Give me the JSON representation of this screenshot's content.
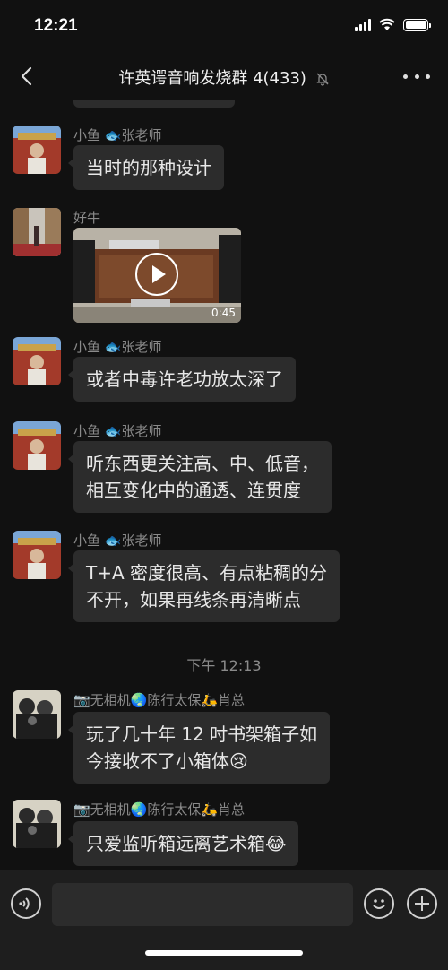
{
  "status_bar": {
    "time": "12:21"
  },
  "nav": {
    "title": "许英谔音响发烧群 4(433)"
  },
  "messages": [
    {
      "sender": "小鱼 🐟张老师",
      "text": "当时的那种设计"
    },
    {
      "sender": "好牛",
      "video_duration": "0:45"
    },
    {
      "sender": "小鱼 🐟张老师",
      "text": "或者中毒许老功放太深了"
    },
    {
      "sender": "小鱼 🐟张老师",
      "line1": "听东西更关注高、中、低音，",
      "line2": "相互变化中的通透、连贯度"
    },
    {
      "sender": "小鱼 🐟张老师",
      "line1": "T+A 密度很高、有点粘稠的分",
      "line2": "不开，如果再线条再清晰点"
    },
    {
      "sender": "📷无相机🌏陈行太保🛵肖总",
      "line1": "玩了几十年 12 吋书架箱子如",
      "line2": "今接收不了小箱体😢"
    },
    {
      "sender": "📷无相机🌏陈行太保🛵肖总",
      "text": "只爱监听箱远离艺术箱😂"
    }
  ],
  "timestamp": "下午 12:13",
  "colors": {
    "background": "#111111",
    "bubble": "#2c2c2c",
    "muted_text": "#8a8a8a"
  }
}
